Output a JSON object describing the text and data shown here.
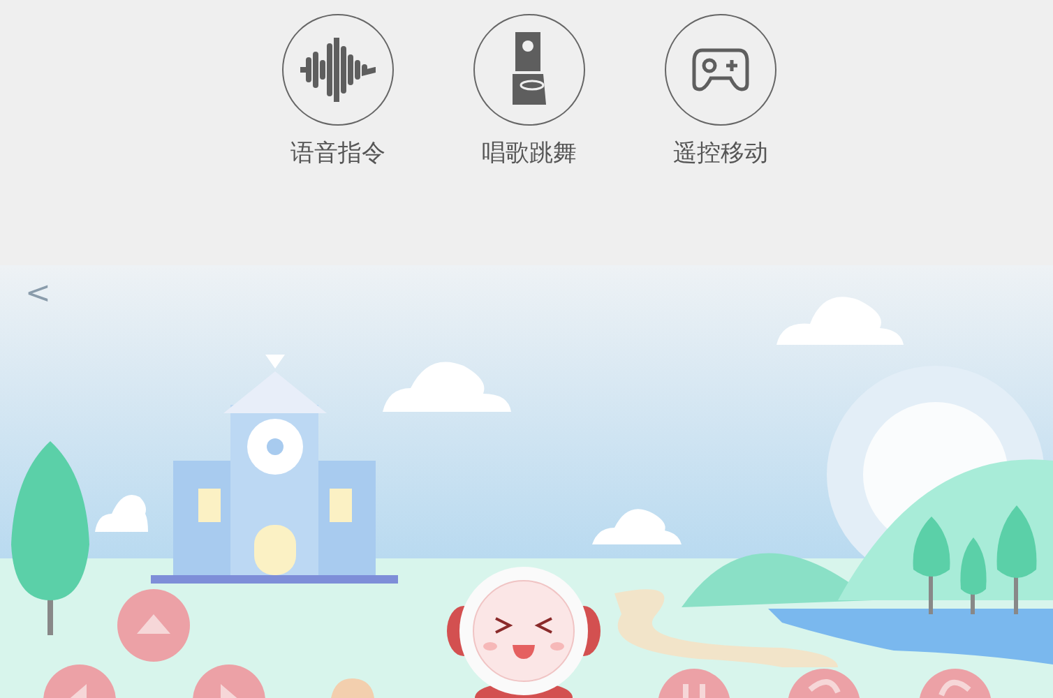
{
  "modes": [
    {
      "label": "语音指令",
      "kind": "voice"
    },
    {
      "label": "唱歌跳舞",
      "kind": "dance"
    },
    {
      "label": "遥控移动",
      "kind": "remote"
    }
  ],
  "back": {
    "glyph": "<"
  }
}
